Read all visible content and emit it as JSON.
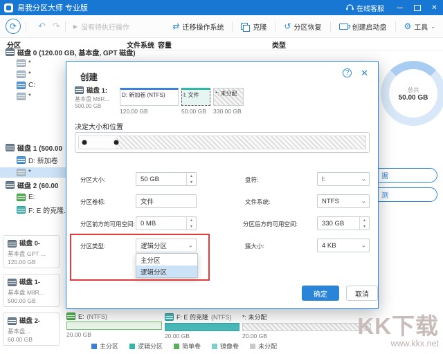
{
  "titlebar": {
    "app_title": "易我分区大师 专业版",
    "online_support": "在线客服"
  },
  "toolbar": {
    "no_pending": "没有待执行操作",
    "migrate_os": "迁移操作系统",
    "clone": "克隆",
    "recovery": "分区恢复",
    "bootable": "创建启动盘",
    "tools": "工具"
  },
  "table_header": {
    "partition": "分区",
    "file_system": "文件系统",
    "capacity": "容量",
    "type": "类型"
  },
  "disk_tree": {
    "disk0_header": "磁盘 0 (120.00 GB, 基本盘, GPT 磁盘)",
    "disk0_items": [
      "*",
      "*",
      "C:",
      "*"
    ],
    "disk1_header": "磁盘 1 (500.00",
    "disk1_items": [
      "D: 新加卷",
      "*"
    ],
    "disk2_header": "磁盘 2 (60.00",
    "disk2_items": [
      "E:",
      "F: E 的克隆..."
    ]
  },
  "disk_cards": [
    {
      "name": "磁盘 0-",
      "desc": "基本盘 GPT ...",
      "size": "120.00 GB"
    },
    {
      "name": "磁盘 1-",
      "desc": "基本盘 M8R...",
      "size": "500.00 GB"
    },
    {
      "name": "磁盘 2-",
      "desc": "基本盘...",
      "size": "60.00 GB"
    }
  ],
  "dialog": {
    "title": "创建",
    "disk": {
      "name": "磁盘 1:",
      "desc": "基本盘 M8R...",
      "size": "500.00 GB"
    },
    "blocks": [
      {
        "name": "D: 新加卷 (NTFS)",
        "size": "120.00 GB"
      },
      {
        "name": "I: 文件",
        "size": "50.00 GB"
      },
      {
        "name": "*: 未分配",
        "size": "330.00 GB"
      }
    ],
    "section_title": "决定大小和位置",
    "partition_size_label": "分区大小:",
    "partition_size_value": "50 GB",
    "drive_letter_label": "盘符:",
    "drive_letter_value": "I:",
    "volume_label_label": "分区卷标:",
    "volume_label_value": "文件",
    "file_system_label": "文件系统:",
    "file_system_value": "NTFS",
    "space_before_label": "分区前方的可用空间:",
    "space_before_value": "0 MB",
    "space_after_label": "分区后方的可用空间:",
    "space_after_value": "330 GB",
    "partition_type_label": "分区类型:",
    "partition_type_value": "逻辑分区",
    "cluster_size_label": "簇大小:",
    "cluster_size_value": "4 KB",
    "type_options": [
      "主分区",
      "逻辑分区"
    ],
    "ok": "确定",
    "cancel": "取消"
  },
  "right_panel": {
    "donut_title": "总共",
    "donut_value": "50.00 GB",
    "button_data": "据",
    "button_test": "测"
  },
  "bottom_map": [
    {
      "name": "E:",
      "fs": "(NTFS)",
      "size": "20.00 GB"
    },
    {
      "name": "F: E 的克隆",
      "fs": "(NTFS)",
      "size": "20.00 GB"
    },
    {
      "name": "*: 未分配",
      "fs": "",
      "size": "20.00 GB"
    }
  ],
  "legend": [
    {
      "label": "主分区",
      "color": "#3d7fd9"
    },
    {
      "label": "逻辑分区",
      "color": "#2fb8a8"
    },
    {
      "label": "简单卷",
      "color": "#58b158"
    },
    {
      "label": "镜像卷",
      "color": "#7fd0c8"
    },
    {
      "label": "未分配",
      "color": "#c9c9c9"
    }
  ],
  "watermark": {
    "title": "KK下载",
    "url": "www.kkx.net"
  },
  "icons": {
    "refresh": "⟳",
    "undo": "↶",
    "redo": "↷",
    "play": "▶",
    "migrate": "⇄",
    "recovery": "↺",
    "tools": "⚙",
    "caret": "⌄",
    "help": "?",
    "close": "✕",
    "up": "▴",
    "down": "▾"
  }
}
